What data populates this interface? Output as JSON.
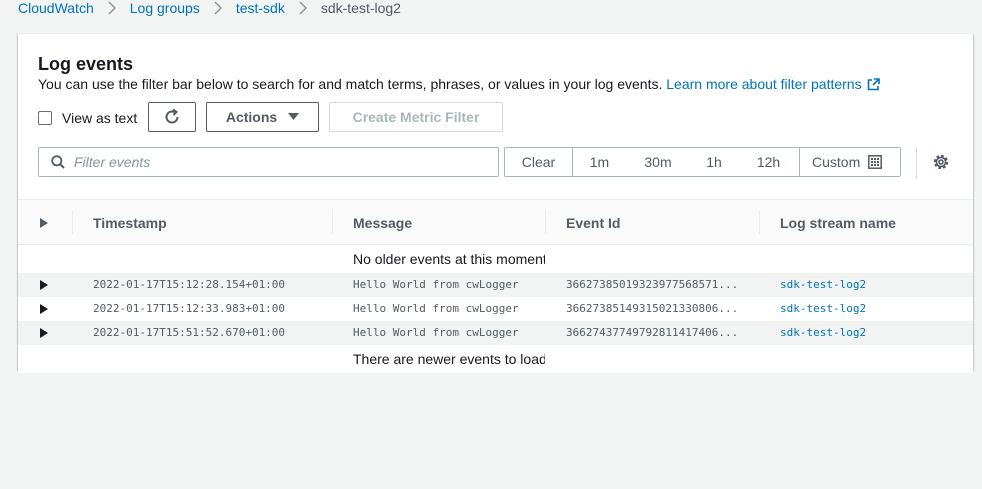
{
  "breadcrumb": {
    "items": [
      {
        "label": "CloudWatch"
      },
      {
        "label": "Log groups"
      },
      {
        "label": "test-sdk"
      }
    ],
    "current": "sdk-test-log2"
  },
  "panel": {
    "title": "Log events",
    "description": "You can use the filter bar below to search for and match terms, phrases, or values in your log events.",
    "learn_more": "Learn more about filter patterns"
  },
  "controls": {
    "view_as_text": "View as text",
    "actions_label": "Actions",
    "create_metric_filter": "Create Metric Filter"
  },
  "filter": {
    "placeholder": "Filter events",
    "value": ""
  },
  "time_range": {
    "clear": "Clear",
    "options": [
      "1m",
      "30m",
      "1h",
      "12h"
    ],
    "custom": "Custom"
  },
  "table": {
    "columns": [
      "Timestamp",
      "Message",
      "Event Id",
      "Log stream name"
    ],
    "older_message": "No older events at this moment.",
    "newer_message": "There are newer events to load.",
    "rows": [
      {
        "timestamp": "2022-01-17T15:12:28.154+01:00",
        "message": "Hello World from cwLogger",
        "event_id": "36627385019323977568571...",
        "log_stream": "sdk-test-log2"
      },
      {
        "timestamp": "2022-01-17T15:12:33.983+01:00",
        "message": "Hello World from cwLogger",
        "event_id": "36627385149315021330806...",
        "log_stream": "sdk-test-log2"
      },
      {
        "timestamp": "2022-01-17T15:51:52.670+01:00",
        "message": "Hello World from cwLogger",
        "event_id": "36627437749792811417406...",
        "log_stream": "sdk-test-log2"
      }
    ]
  },
  "icons": {
    "breadcrumb_separator": "chevron-right-icon",
    "external_link": "external-link-icon",
    "refresh": "refresh-icon",
    "actions_caret": "caret-down-icon",
    "search": "search-icon",
    "calendar": "calendar-icon",
    "settings": "gear-icon",
    "expand": "caret-right-icon"
  },
  "colors": {
    "link": "#0073bb",
    "text": "#16191f",
    "secondary_text": "#545b64",
    "background": "#f2f3f3",
    "row_shaded": "#f2f3f3"
  }
}
